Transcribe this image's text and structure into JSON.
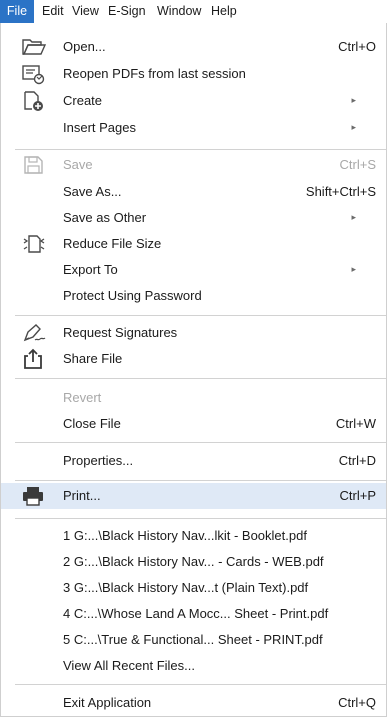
{
  "menubar": {
    "items": [
      "File",
      "Edit",
      "View",
      "E-Sign",
      "Window",
      "Help"
    ],
    "active": "File"
  },
  "menu": {
    "open": {
      "label": "Open...",
      "shortcut": "Ctrl+O"
    },
    "reopen": {
      "label": "Reopen PDFs from last session"
    },
    "create": {
      "label": "Create"
    },
    "insert_pages": {
      "label": "Insert Pages"
    },
    "save": {
      "label": "Save",
      "shortcut": "Ctrl+S"
    },
    "save_as": {
      "label": "Save As...",
      "shortcut": "Shift+Ctrl+S"
    },
    "save_as_other": {
      "label": "Save as Other"
    },
    "reduce": {
      "label": "Reduce File Size"
    },
    "export": {
      "label": "Export To"
    },
    "protect": {
      "label": "Protect Using Password"
    },
    "request_sig": {
      "label": "Request Signatures"
    },
    "share": {
      "label": "Share File"
    },
    "revert": {
      "label": "Revert"
    },
    "close": {
      "label": "Close File",
      "shortcut": "Ctrl+W"
    },
    "properties": {
      "label": "Properties...",
      "shortcut": "Ctrl+D"
    },
    "print": {
      "label": "Print...",
      "shortcut": "Ctrl+P"
    },
    "recent": [
      "1 G:...\\Black History Nav...lkit - Booklet.pdf",
      "2 G:...\\Black History Nav... - Cards - WEB.pdf",
      "3 G:...\\Black History Nav...t (Plain Text).pdf",
      "4 C:...\\Whose Land A Mocc... Sheet - Print.pdf",
      "5 C:...\\True & Functional... Sheet - PRINT.pdf"
    ],
    "view_all_recent": {
      "label": "View All Recent Files..."
    },
    "exit": {
      "label": "Exit Application",
      "shortcut": "Ctrl+Q"
    }
  },
  "colors": {
    "accent": "#2b73c6",
    "hover": "#dfe9f6",
    "disabled": "#a8a8a8"
  }
}
